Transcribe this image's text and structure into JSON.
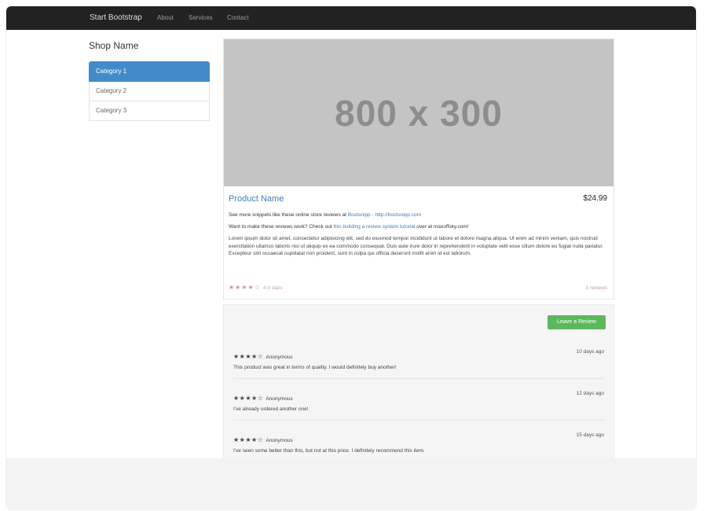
{
  "navbar": {
    "brand": "Start Bootstrap",
    "links": [
      "About",
      "Services",
      "Contact"
    ]
  },
  "sidebar": {
    "title": "Shop Name",
    "items": [
      "Category 1",
      "Category 2",
      "Category 3"
    ]
  },
  "product": {
    "image_text": "800 x 300",
    "name": "Product Name",
    "price": "$24.99",
    "line1_prefix": "See more snippets like these online store reviews at",
    "line1_link": "Bootsnipp - http://bootsnipp.com",
    "line2_prefix": "Want to make these reviews work? Check out",
    "line2_link": "this building a review system tutorial",
    "line2_suffix": "over at maxoffsky.com!",
    "description": "Lorem ipsum dolor sit amet, consectetur adipisicing elit, sed do eiusmod tempor incididunt ut labore et dolore magna aliqua. Ut enim ad minim veniam, quis nostrud exercitation ullamco laboris nisi ut aliquip ex ea commodo consequat. Duis aute irure dolor in reprehenderit in voluptate velit esse cillum dolore eu fugiat nulla pariatur. Excepteur sint occaecat cupidatat non proident, sunt in culpa qui officia deserunt mollit anim id est laborum.",
    "rating_stars": "★★★★☆",
    "rating_text": "4.0 stars",
    "reviews_count": "3 reviews"
  },
  "reviews_section": {
    "leave_button": "Leave a Review",
    "reviews": [
      {
        "stars": "★★★★☆",
        "author": "Anonymous",
        "time": "10 days ago",
        "text": "This product was great in terms of quality. I would definitely buy another!"
      },
      {
        "stars": "★★★★☆",
        "author": "Anonymous",
        "time": "12 days ago",
        "text": "I've already ordered another one!"
      },
      {
        "stars": "★★★★☆",
        "author": "Anonymous",
        "time": "15 days ago",
        "text": "I've seen some better than this, but not at this price. I definitely recommend this item."
      }
    ]
  },
  "colors": {
    "navbar": "#222222",
    "active_category": "#428bca",
    "link": "#3a7fc1",
    "button": "#5cb85c",
    "placeholder": "#c4c4c4"
  }
}
